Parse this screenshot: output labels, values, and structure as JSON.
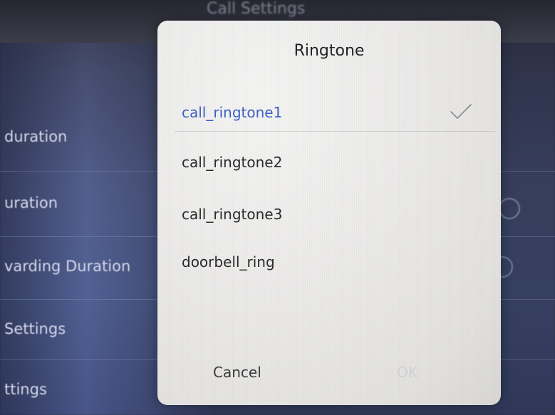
{
  "background": {
    "header_title": "Call Settings",
    "rows": [
      {
        "label": "duration"
      },
      {
        "label": "uration"
      },
      {
        "label": "varding Duration"
      },
      {
        "label": "Settings"
      },
      {
        "label": "ttings"
      }
    ]
  },
  "dialog": {
    "title": "Ringtone",
    "options": [
      {
        "label": "call_ringtone1",
        "selected": true
      },
      {
        "label": "call_ringtone2",
        "selected": false
      },
      {
        "label": "call_ringtone3",
        "selected": false
      },
      {
        "label": "doorbell_ring",
        "selected": false
      }
    ],
    "cancel_label": "Cancel",
    "ok_label": "OK",
    "selected_icon": "check-icon",
    "accent_color": "#3d5fc0"
  }
}
